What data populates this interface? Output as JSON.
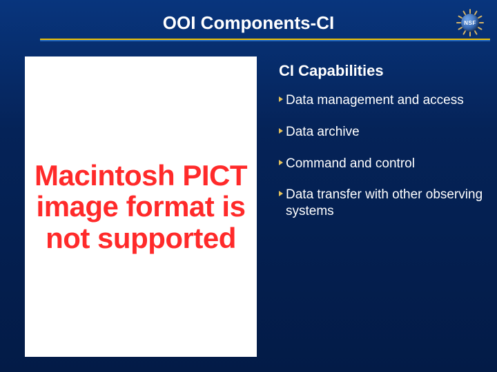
{
  "header": {
    "title": "OOI Components-CI",
    "logo_text": "NSF"
  },
  "image_placeholder": {
    "text": "Macintosh PICT image format is not supported"
  },
  "section": {
    "title": "CI Capabilities",
    "items": [
      "Data management and access",
      "Data archive",
      "Command and control",
      "Data transfer with other observing systems"
    ]
  }
}
